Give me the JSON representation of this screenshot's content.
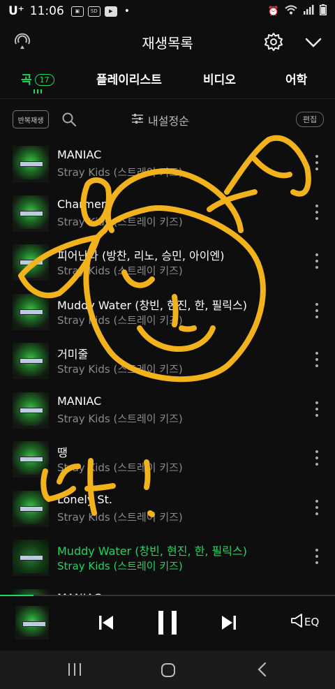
{
  "status_bar": {
    "carrier": "U⁺",
    "time": "11:06",
    "icons": [
      "gallery-icon",
      "sdcard-icon",
      "youtube-icon",
      "alarm-icon",
      "wifi-icon",
      "signal-icon",
      "battery-icon"
    ],
    "dot": "•"
  },
  "header": {
    "title": "재생목록"
  },
  "tabs": [
    {
      "label": "곡",
      "count": "17",
      "active": true
    },
    {
      "label": "플레이리스트"
    },
    {
      "label": "비디오"
    },
    {
      "label": "어학"
    }
  ],
  "toolbar": {
    "repeat_label": "반복재생",
    "sort_label": "내설정순",
    "edit_label": "편집"
  },
  "songs": [
    {
      "title": "MANIAC",
      "artist": "Stray Kids (스트레이 키즈)"
    },
    {
      "title": "Charmer",
      "artist": "Stray Kids (스트레이 키즈)"
    },
    {
      "title": "피어난다 (방찬, 리노, 승민, 아이엔)",
      "artist": "Stray Kids (스트레이 키즈)"
    },
    {
      "title": "Muddy Water (창빈, 현진, 한, 필릭스)",
      "artist": "Stray Kids (스트레이 키즈)"
    },
    {
      "title": "거미줄",
      "artist": "Stray Kids (스트레이 키즈)"
    },
    {
      "title": "MANIAC",
      "artist": "Stray Kids (스트레이 키즈)"
    },
    {
      "title": "땡",
      "artist": "Stray Kids (스트레이 키즈)"
    },
    {
      "title": "Lonely St.",
      "artist": "Stray Kids (스트레이 키즈)"
    },
    {
      "title": "Muddy Water (창빈, 현진, 한, 필릭스)",
      "artist": "Stray Kids (스트레이 키즈)",
      "current": true
    },
    {
      "title": "MANIAC",
      "artist": ""
    }
  ],
  "player": {
    "progress": 0.1,
    "eq_label": "EQ"
  },
  "colors": {
    "accent": "#1ed760",
    "background": "#0e0e0e",
    "scribble": "#f2b21b",
    "secondary_text": "#8a8a8a"
  }
}
